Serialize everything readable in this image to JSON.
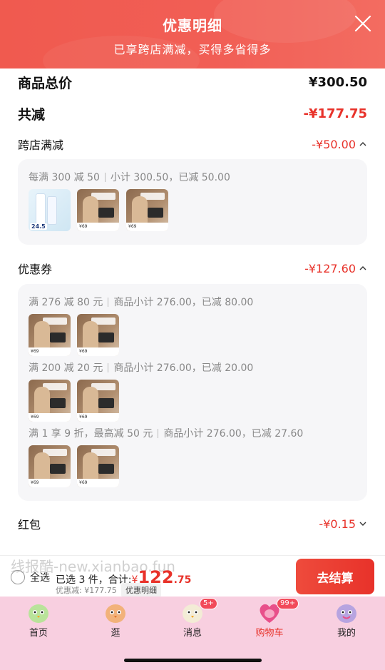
{
  "header": {
    "title": "优惠明细",
    "subtitle": "已享跨店满减，买得多省得多"
  },
  "summary": {
    "total_label": "商品总价",
    "total_value": "¥300.50",
    "reduced_label": "共减",
    "reduced_value": "-¥177.75"
  },
  "cross_store": {
    "label": "跨店满减",
    "value": "-¥50.00",
    "rule_main": "每满 300 减 50",
    "rule_sub": "小计 300.50，已减 50.00"
  },
  "coupon": {
    "label": "优惠券",
    "value": "-¥127.60",
    "rules": [
      {
        "main": "满 276 减 80 元",
        "sub": "商品小计 276.00，已减 80.00"
      },
      {
        "main": "满 200 减 20 元",
        "sub": "商品小计 276.00，已减 20.00"
      },
      {
        "main": "满 1 享 9 折，最高减 50 元",
        "sub": "商品小计 276.00，已减 27.60"
      }
    ]
  },
  "red_packet": {
    "label": "红包",
    "value": "-¥0.15"
  },
  "thumbs": {
    "tooth_tag": "24.5",
    "price_tag": "¥69"
  },
  "checkout_bar": {
    "select_all": "全选",
    "selected_text": "已选 3 件，合计:",
    "currency": "¥",
    "amount_int": "122",
    "amount_dec": ".75",
    "saved_text": "优惠减: ¥177.75",
    "detail_label": "优惠明细",
    "checkout_label": "去结算",
    "watermark": "线报酷-new.xianbao.fun"
  },
  "tabbar": {
    "items": [
      {
        "label": "首页"
      },
      {
        "label": "逛"
      },
      {
        "label": "消息",
        "badge": "5+"
      },
      {
        "label": "购物车",
        "badge": "99+"
      },
      {
        "label": "我的"
      }
    ]
  },
  "colors": {
    "accent": "#e8322a",
    "header": "#f15e55",
    "tabbar": "#f8cfe0"
  }
}
